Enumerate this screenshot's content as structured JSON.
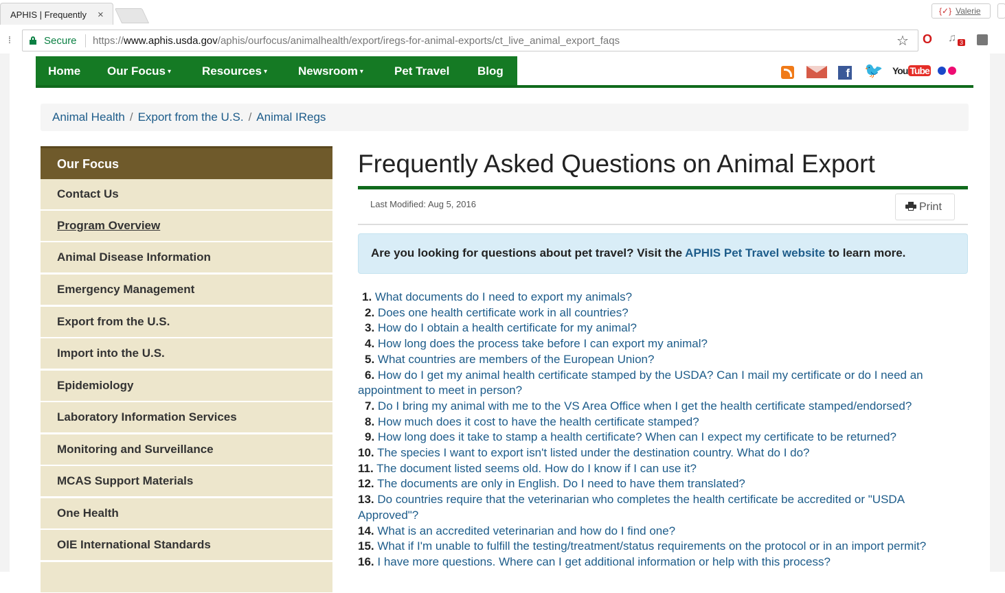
{
  "browser": {
    "tab_title": "APHIS | Frequently",
    "tab_close": "×",
    "profile_glyph": "{✓}",
    "profile_name": "Valerie",
    "secure_label": "Secure",
    "url_prefix": "https://",
    "url_host": "www.aphis.usda.gov",
    "url_path": "/aphis/ourfocus/animalhealth/export/iregs-for-animal-exports/ct_live_animal_export_faqs",
    "star_glyph": "☆",
    "extension_badge": "3"
  },
  "nav": {
    "items": [
      "Home",
      "Our Focus",
      "Resources",
      "Newsroom",
      "Pet Travel",
      "Blog"
    ],
    "caret": "▾",
    "social": [
      "rss-icon",
      "email-icon",
      "facebook-icon",
      "twitter-icon",
      "youtube-icon",
      "flickr-icon"
    ],
    "youtube_you": "You",
    "youtube_tube": "Tube",
    "facebook_glyph": "f",
    "twitter_glyph": "🐦",
    "accent": "#157a24"
  },
  "breadcrumb": {
    "items": [
      "Animal Health",
      "Export from the U.S.",
      "Animal IRegs"
    ],
    "separator": "/"
  },
  "sidebar": {
    "heading": "Our Focus",
    "items": [
      "Contact Us",
      "Program Overview",
      "Animal Disease Information",
      "Emergency Management",
      "Export from the U.S.",
      "Import into the U.S.",
      "Epidemiology",
      "Laboratory Information Services",
      "Monitoring and Surveillance",
      "MCAS Support Materials",
      "One Health",
      "OIE International Standards"
    ],
    "header_color": "#6f5a2b",
    "item_color": "#ede6cc"
  },
  "main": {
    "title": "Frequently Asked Questions on Animal Export",
    "last_modified": "Last Modified: Aug 5, 2016",
    "print_label": "Print",
    "alert_pre": "Are you looking for questions about pet travel? Visit the ",
    "alert_link": "APHIS Pet Travel website",
    "alert_post": " to learn more.",
    "faqs": [
      {
        "num": "1.",
        "text": "What documents do I need to export my animals?"
      },
      {
        "num": "2.",
        "text": "Does one health certificate work in all countries?"
      },
      {
        "num": "3.",
        "text": "How do I obtain a health certificate for my animal?"
      },
      {
        "num": "4.",
        "text": "How long does the process take before I can export my animal?"
      },
      {
        "num": "5.",
        "text": "What countries are members of the European Union?"
      },
      {
        "num": "6.",
        "text": "How do I get my animal health certificate stamped by the USDA? Can I mail my certificate or do I need an appointment to meet in person?"
      },
      {
        "num": "7.",
        "text": "Do I bring my animal with me to the VS Area Office when I get the health certificate stamped/endorsed?"
      },
      {
        "num": "8.",
        "text": "How much does it cost to have the health certificate stamped?"
      },
      {
        "num": "9.",
        "text": "How long does it take to stamp a health certificate? When can I expect my certificate to be returned?"
      },
      {
        "num": "10.",
        "text": "The species I want to export isn't listed under the destination country. What do I do?"
      },
      {
        "num": "11.",
        "text": "The document listed seems old. How do I know if I can use it?"
      },
      {
        "num": "12.",
        "text": "The documents are only in English. Do I need to have them translated?"
      },
      {
        "num": "13.",
        "text": "Do countries require that the veterinarian who completes the health certificate be accredited or \"USDA Approved\"?"
      },
      {
        "num": "14.",
        "text": "What is an accredited veterinarian and how do I find one?"
      },
      {
        "num": "15.",
        "text": "What if I'm unable to fulfill the testing/treatment/status requirements on the protocol or in an import permit?"
      },
      {
        "num": "16.",
        "text": "I have more questions. Where can I get additional information or help with this process?"
      }
    ],
    "link_color": "#1d5c8a"
  }
}
